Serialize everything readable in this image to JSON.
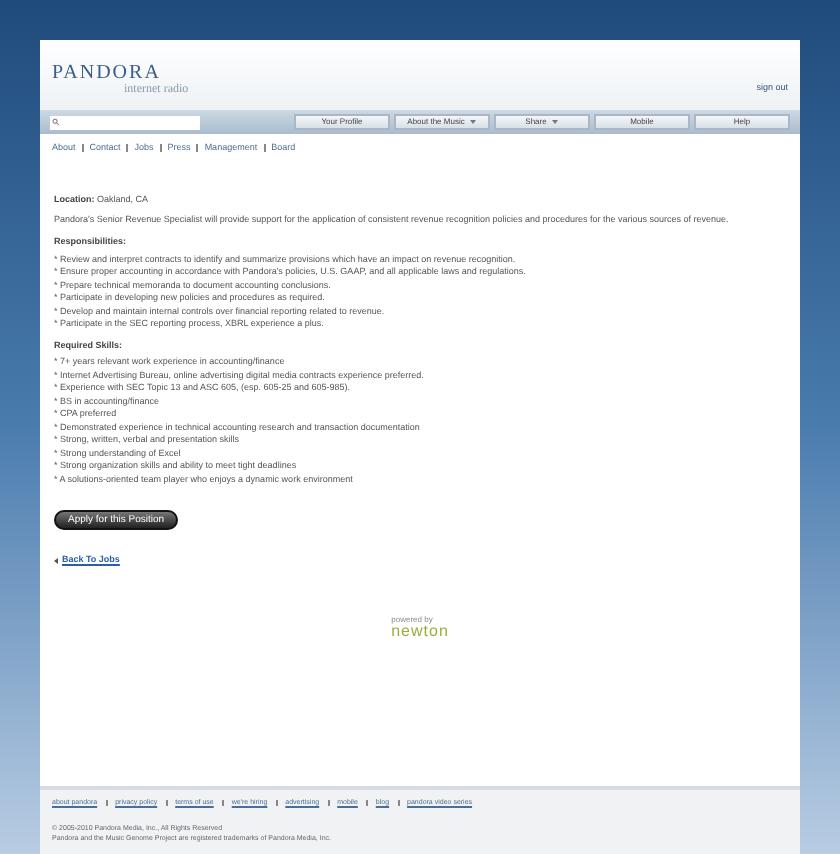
{
  "header": {
    "logo": "PANDORA",
    "tagline": "internet radio",
    "sign_out": "sign out"
  },
  "nav_tabs": [
    {
      "label": "Your Profile",
      "dropdown": false
    },
    {
      "label": "About the Music",
      "dropdown": true
    },
    {
      "label": "Share",
      "dropdown": true
    },
    {
      "label": "Mobile",
      "dropdown": false
    },
    {
      "label": "Help",
      "dropdown": false
    }
  ],
  "sub_links": [
    "About",
    "Contact",
    "Jobs",
    "Press",
    "Management",
    "Board"
  ],
  "location": {
    "label": "Location:",
    "value": "Oakland, CA"
  },
  "intro": "Pandora's Senior Revenue Specialist will provide support for the application of consistent revenue recognition policies and procedures for the various sources of revenue.",
  "sections": [
    {
      "heading": "Responsibilities:",
      "items": [
        "* Review and interpret contracts to identify and summarize provisions which have an impact on revenue recognition.",
        "* Ensure proper accounting in accordance with Pandora's policies, U.S. GAAP, and all applicable laws and regulations.",
        "* Prepare technical memoranda to document accounting conclusions.",
        "* Participate in developing new policies and procedures as required.",
        "* Develop and maintain internal controls over financial reporting related to revenue.",
        "* Participate in the SEC reporting process, XBRL experience a plus."
      ]
    },
    {
      "heading": "Required Skills:",
      "items": [
        "* 7+ years relevant work experience in accounting/finance",
        "* Internet Advertising Bureau, online advertising digital media contracts experience preferred.",
        "* Experience with SEC Topic 13 and ASC 605, (esp. 605-25 and 605-985).",
        "* BS in accounting/finance",
        "* CPA preferred",
        "* Demonstrated experience in technical accounting research and transaction documentation",
        "* Strong, written, verbal and presentation skills",
        "* Strong understanding of Excel",
        "* Strong organization skills and ability to meet tight deadlines",
        "* A solutions-oriented team player who enjoys a dynamic work environment"
      ]
    }
  ],
  "apply_button": "Apply for this Position",
  "back_link": "Back To Jobs",
  "powered": {
    "caption": "powered by",
    "brand": "newton"
  },
  "footer_links": [
    "about pandora",
    "privacy policy",
    "terms of use",
    "we're hiring",
    "advertising",
    "mobile",
    "blog",
    "pandora video series"
  ],
  "copyright": [
    "© 2005-2010 Pandora Media, Inc., All Rights Reserved",
    "Pandora and the Music Genome Project are registered trademarks of Pandora Media, Inc."
  ]
}
